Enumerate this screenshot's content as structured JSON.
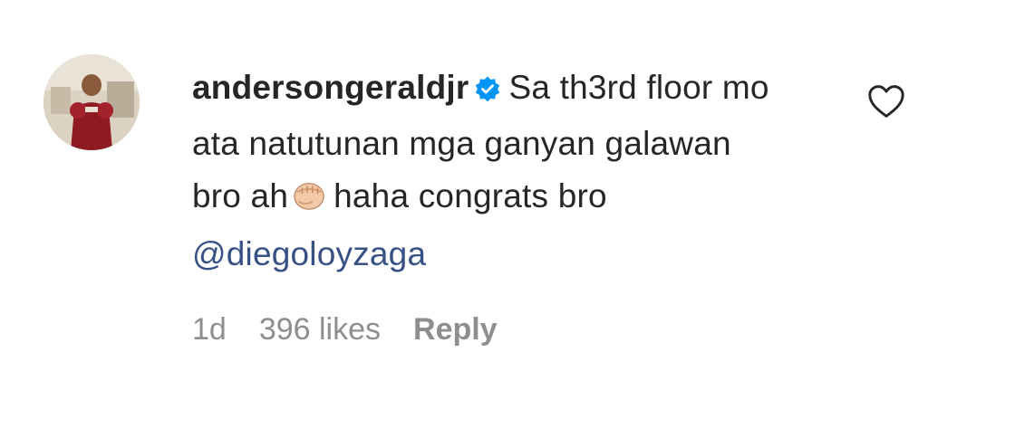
{
  "comment": {
    "username": "andersongeraldjr",
    "verified_icon": "verified-badge-icon",
    "text_part1": "Sa th3rd floor mo ata natutunan mga ganyan galawan bro ah",
    "emoji_icon": "fist-bump-emoji",
    "text_part2": "haha congrats bro",
    "mention": "@diegoloyzaga",
    "like_icon": "heart-outline-icon",
    "accent_color": "#0095f6",
    "mention_color": "#385185"
  },
  "meta": {
    "time": "1d",
    "likes": "396 likes",
    "reply_label": "Reply"
  }
}
